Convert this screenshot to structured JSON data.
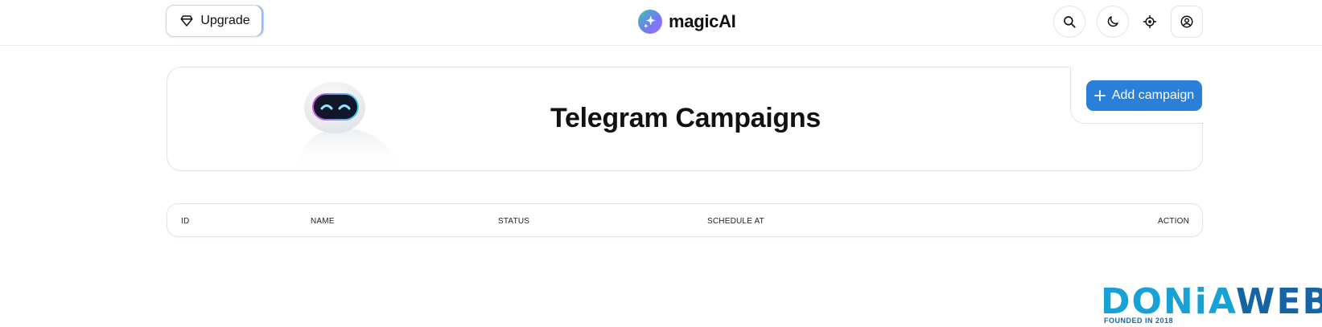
{
  "header": {
    "upgrade_label": "Upgrade",
    "brand_name": "magicAI",
    "icons": [
      "diamond-icon",
      "search-icon",
      "moon-icon",
      "crosshair-icon",
      "user-circle-icon"
    ]
  },
  "hero": {
    "title": "Telegram Campaigns",
    "add_button_label": "Add campaign"
  },
  "table": {
    "columns": [
      "ID",
      "NAME",
      "STATUS",
      "SCHEDULE AT",
      "ACTION"
    ]
  },
  "watermark": {
    "word_light": "DONiA",
    "word_dark": "WEB",
    "tagline": "FOUNDED IN 2018"
  },
  "colors": {
    "primary_button": "#2a7fd8",
    "brand_gradient": [
      "#37c6a8",
      "#6f7cf6",
      "#a86bf2"
    ],
    "watermark_light": "#17a2d6",
    "watermark_dark": "#1565a6"
  }
}
